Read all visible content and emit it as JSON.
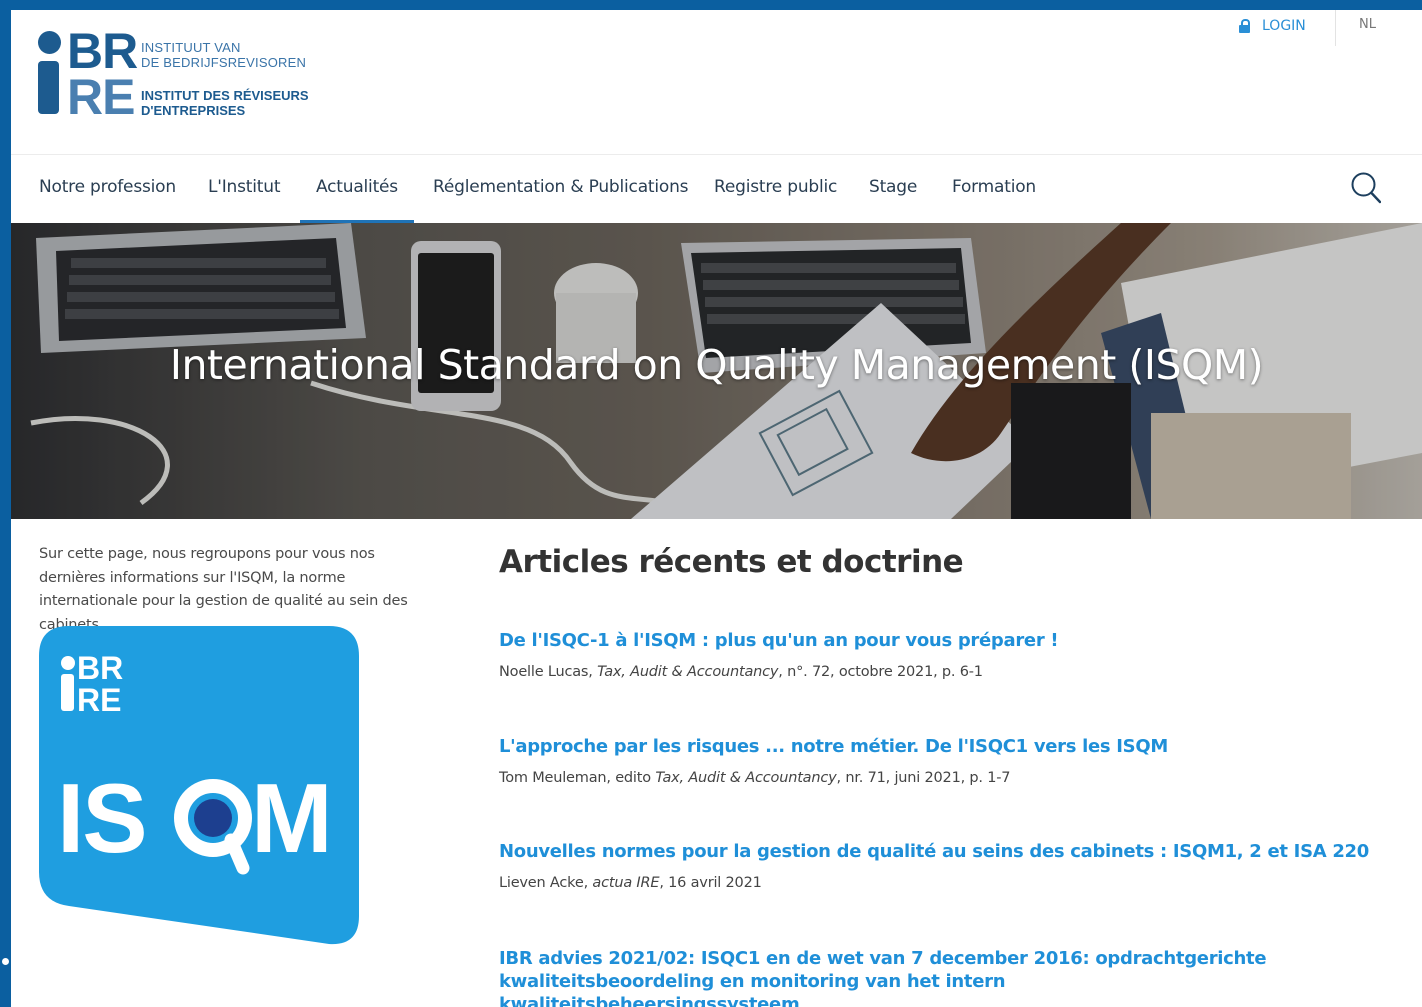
{
  "header": {
    "logo": {
      "letters_top": "BR",
      "letters_bottom": "RE",
      "name_nl_line1": "INSTITUUT VAN",
      "name_nl_line2": "DE BEDRIJFSREVISOREN",
      "name_fr_line1": "INSTITUT DES RÉVISEURS",
      "name_fr_line2": "D'ENTREPRISES"
    },
    "login_label": "LOGIN",
    "lang_label": "NL"
  },
  "nav": {
    "items": [
      {
        "label": "Notre profession"
      },
      {
        "label": "L'Institut"
      },
      {
        "label": "Actualités",
        "active": true
      },
      {
        "label": "Réglementation & Publications"
      },
      {
        "label": "Registre public"
      },
      {
        "label": "Stage"
      },
      {
        "label": "Formation"
      }
    ],
    "search_icon": "search-icon"
  },
  "hero": {
    "title": "International Standard on Quality Management (ISQM)"
  },
  "intro": {
    "text": "Sur cette page, nous regroupons pour vous nos dernières informations sur l'ISQM, la norme internationale pour la gestion de qualité au sein des cabinets."
  },
  "isqm_card": {
    "logo_top": "BR",
    "logo_bottom": "RE",
    "word_before_q": "IS",
    "word_after_q": "M",
    "color": "#1f9ee0"
  },
  "articles_section": {
    "title": "Articles récents et doctrine",
    "articles": [
      {
        "title": "De l'ISQC-1 à l'ISQM : plus qu'un an pour vous préparer !",
        "author": "Noelle Lucas, ",
        "journal": "Tax, Audit & Accountancy",
        "details": ", n°. 72, octobre 2021, p. 6-1"
      },
      {
        "title": "L'approche par les risques ... notre métier. De l'ISQC1 vers les ISQM",
        "author": "Tom Meuleman, edito ",
        "journal": "Tax, Audit & Accountancy",
        "details": ", nr. 71, juni 2021, p. 1-7"
      },
      {
        "title": "Nouvelles normes pour la gestion de qualité au seins des cabinets : ISQM1, 2 et ISA 220",
        "author": "Lieven Acke, ",
        "journal": "actua IRE",
        "details": ", 16 avril 2021"
      },
      {
        "title": "IBR advies 2021/02: ISQC1 en de wet van 7 december 2016: opdrachtgerichte kwaliteitsbeoordeling en monitoring van het intern kwaliteitsbeheersingssysteem"
      }
    ]
  },
  "colors": {
    "brand_dark": "#1d5b8f",
    "link_blue": "#1f8fd8",
    "nav_underline": "#1f73b7",
    "window_frame": "#0b5fa0"
  }
}
